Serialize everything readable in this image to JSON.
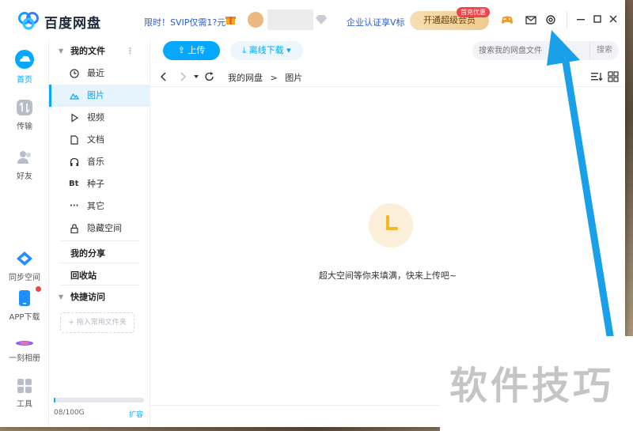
{
  "app": {
    "brand": "百度网盘",
    "promo": "限时！SVIP仅需1?元",
    "enterprise_link": "企业认证享V标",
    "vip_button": "开通超级会员",
    "vip_badge": "首充优惠",
    "accent_color": "#06a7ff"
  },
  "titlebar_icons": [
    "gift-icon",
    "game-icon",
    "mail-icon",
    "settings-icon",
    "minimize-icon",
    "maximize-icon",
    "close-icon"
  ],
  "rail": {
    "items": [
      {
        "label": "首页",
        "icon": "home-cloud-icon",
        "active": true
      },
      {
        "label": "传输",
        "icon": "transfer-icon"
      },
      {
        "label": "好友",
        "icon": "friends-icon"
      },
      {
        "label": "同步空间",
        "icon": "sync-icon"
      },
      {
        "label": "APP下载",
        "icon": "phone-icon"
      },
      {
        "label": "一刻相册",
        "icon": "album-icon"
      },
      {
        "label": "工具",
        "icon": "tools-icon"
      }
    ]
  },
  "sidebar": {
    "my_files": "我的文件",
    "more": "⋮",
    "items": [
      {
        "label": "最近",
        "icon": "clock-icon"
      },
      {
        "label": "图片",
        "icon": "image-icon",
        "active": true
      },
      {
        "label": "视频",
        "icon": "play-icon"
      },
      {
        "label": "文档",
        "icon": "doc-icon"
      },
      {
        "label": "音乐",
        "icon": "headphone-icon"
      },
      {
        "label": "种子",
        "icon": "bt-icon",
        "glyph": "Bt"
      },
      {
        "label": "其它",
        "icon": "more-icon",
        "glyph": "···"
      },
      {
        "label": "隐藏空间",
        "icon": "lock-icon"
      }
    ],
    "my_share": "我的分享",
    "recycle": "回收站",
    "quick_access": "快捷访问",
    "drag_hint": "+ 拖入常用文件夹",
    "quota": "08/100G",
    "quota_fraction": 0.01,
    "expand": "扩容"
  },
  "toolbar": {
    "upload": "上传",
    "offline_download": "离线下载",
    "search_placeholder": "搜索我的网盘文件",
    "search_button": "搜索"
  },
  "breadcrumb": {
    "root": "我的网盘",
    "separator": ">",
    "current": "图片"
  },
  "empty": {
    "message": "超大空间等你来填满，快来上传吧~"
  },
  "watermark": "软件技巧"
}
